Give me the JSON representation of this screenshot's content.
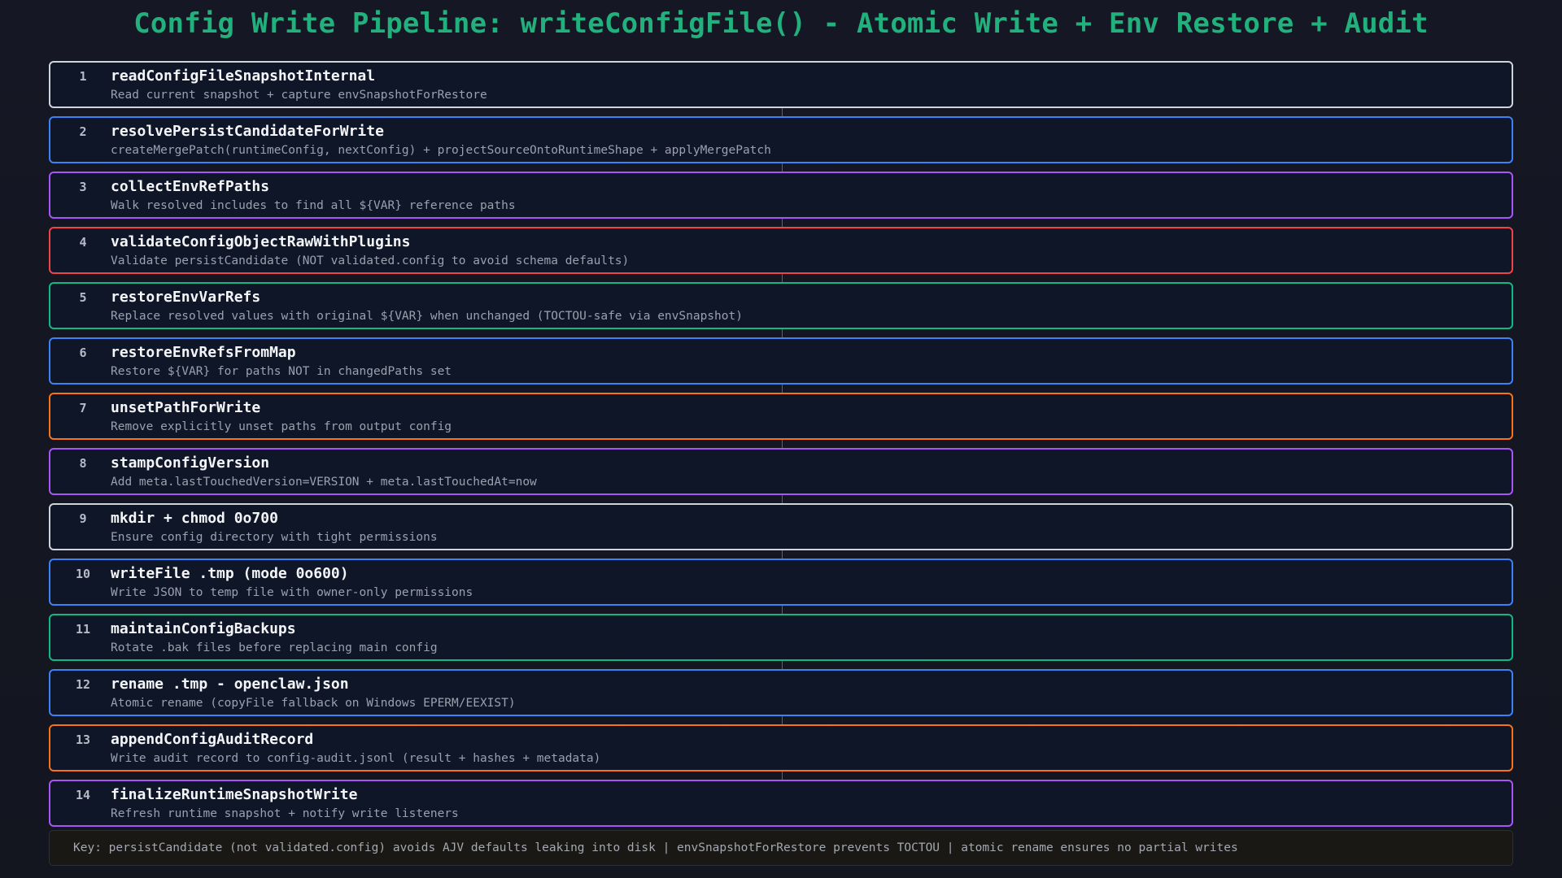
{
  "title": "Config Write Pipeline: writeConfigFile() - Atomic Write + Env Restore + Audit",
  "steps": [
    {
      "num": "1",
      "name": "readConfigFileSnapshotInternal",
      "desc": "Read current snapshot + capture envSnapshotForRestore",
      "color": "#cfd3dc"
    },
    {
      "num": "2",
      "name": "resolvePersistCandidateForWrite",
      "desc": "createMergePatch(runtimeConfig, nextConfig) + projectSourceOntoRuntimeShape + applyMergePatch",
      "color": "#3b82f6"
    },
    {
      "num": "3",
      "name": "collectEnvRefPaths",
      "desc": "Walk resolved includes to find all ${VAR} reference paths",
      "color": "#a855f7"
    },
    {
      "num": "4",
      "name": "validateConfigObjectRawWithPlugins",
      "desc": "Validate persistCandidate (NOT validated.config to avoid schema defaults)",
      "color": "#ef4444"
    },
    {
      "num": "5",
      "name": "restoreEnvVarRefs",
      "desc": "Replace resolved values with original ${VAR} when unchanged (TOCTOU-safe via envSnapshot)",
      "color": "#10b981"
    },
    {
      "num": "6",
      "name": "restoreEnvRefsFromMap",
      "desc": "Restore ${VAR} for paths NOT in changedPaths set",
      "color": "#3b82f6"
    },
    {
      "num": "7",
      "name": "unsetPathForWrite",
      "desc": "Remove explicitly unset paths from output config",
      "color": "#f97316"
    },
    {
      "num": "8",
      "name": "stampConfigVersion",
      "desc": "Add meta.lastTouchedVersion=VERSION + meta.lastTouchedAt=now",
      "color": "#a855f7"
    },
    {
      "num": "9",
      "name": "mkdir + chmod 0o700",
      "desc": "Ensure config directory with tight permissions",
      "color": "#cfd3dc"
    },
    {
      "num": "10",
      "name": "writeFile .tmp (mode 0o600)",
      "desc": "Write JSON to temp file with owner-only permissions",
      "color": "#3b82f6"
    },
    {
      "num": "11",
      "name": "maintainConfigBackups",
      "desc": "Rotate .bak files before replacing main config",
      "color": "#10b981"
    },
    {
      "num": "12",
      "name": "rename .tmp - openclaw.json",
      "desc": "Atomic rename (copyFile fallback on Windows EPERM/EEXIST)",
      "color": "#3b82f6"
    },
    {
      "num": "13",
      "name": "appendConfigAuditRecord",
      "desc": "Write audit record to config-audit.jsonl (result + hashes + metadata)",
      "color": "#f97316"
    },
    {
      "num": "14",
      "name": "finalizeRuntimeSnapshotWrite",
      "desc": "Refresh runtime snapshot + notify write listeners",
      "color": "#a855f7"
    }
  ],
  "key": "Key: persistCandidate (not validated.config) avoids AJV defaults leaking into disk | envSnapshotForRestore prevents TOCTOU | atomic rename ensures no partial writes"
}
